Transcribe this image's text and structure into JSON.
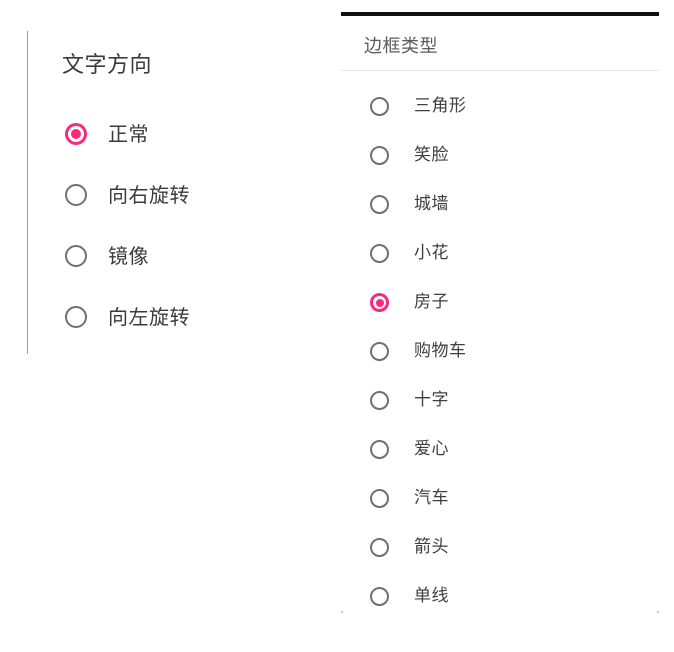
{
  "theme": {
    "accent_color": "#f72a7e",
    "radio_off_color": "#6f7072",
    "text_color": "#3b3b3b",
    "title_color": "#5b5b5b",
    "rule_color": "#101010",
    "divider_color": "#e7e7e7",
    "background": "#ffffff"
  },
  "left_panel": {
    "title": "文字方向",
    "selected_index": 0,
    "options": [
      {
        "label": "正常",
        "selected": true
      },
      {
        "label": "向右旋转",
        "selected": false
      },
      {
        "label": "镜像",
        "selected": false
      },
      {
        "label": "向左旋转",
        "selected": false
      }
    ]
  },
  "right_panel": {
    "title": "边框类型",
    "selected_index": 4,
    "options": [
      {
        "label": "三角形",
        "selected": false
      },
      {
        "label": "笑脸",
        "selected": false
      },
      {
        "label": "城墙",
        "selected": false
      },
      {
        "label": "小花",
        "selected": false
      },
      {
        "label": "房子",
        "selected": true
      },
      {
        "label": "购物车",
        "selected": false
      },
      {
        "label": "十字",
        "selected": false
      },
      {
        "label": "爱心",
        "selected": false
      },
      {
        "label": "汽车",
        "selected": false
      },
      {
        "label": "箭头",
        "selected": false
      },
      {
        "label": "单线",
        "selected": false
      }
    ]
  }
}
